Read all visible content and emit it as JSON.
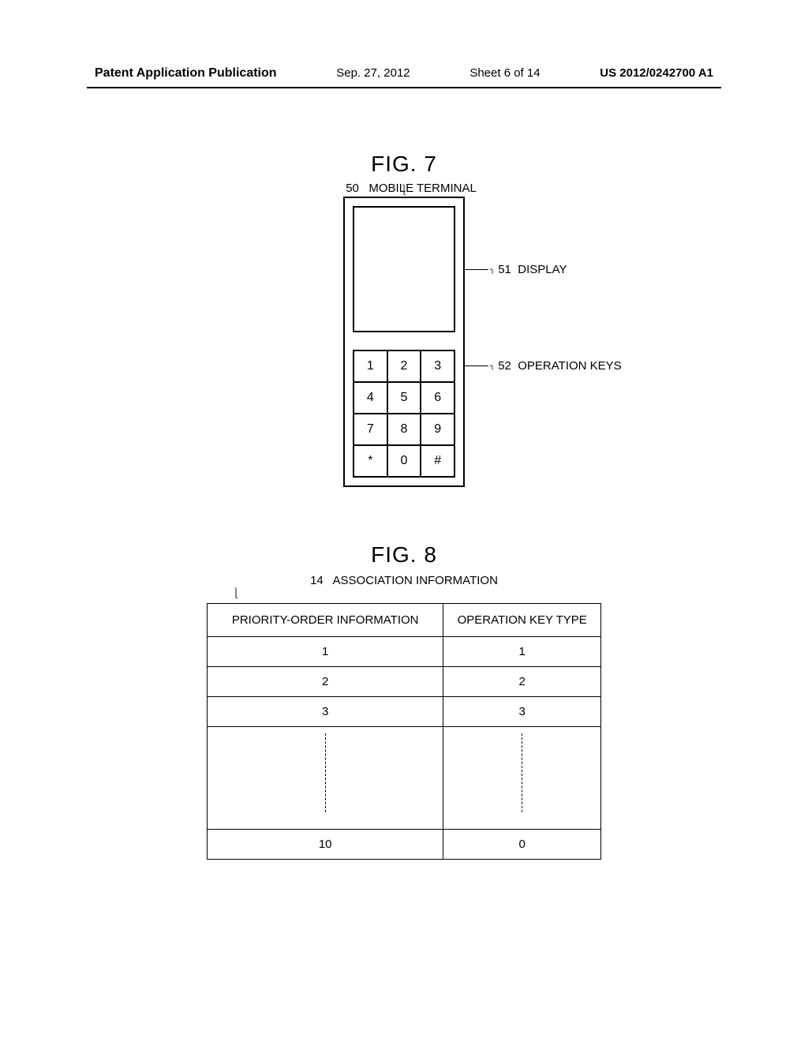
{
  "header": {
    "publication": "Patent Application Publication",
    "date": "Sep. 27, 2012",
    "sheet": "Sheet 6 of 14",
    "pubno": "US 2012/0242700 A1"
  },
  "fig7": {
    "title": "FIG. 7",
    "ref50_num": "50",
    "ref50_label": "MOBILE TERMINAL",
    "ref51_num": "51",
    "ref51_label": "DISPLAY",
    "ref52_num": "52",
    "ref52_label": "OPERATION KEYS",
    "keys": [
      "1",
      "2",
      "3",
      "4",
      "5",
      "6",
      "7",
      "8",
      "9",
      "*",
      "0",
      "#"
    ]
  },
  "fig8": {
    "title": "FIG. 8",
    "ref14_num": "14",
    "ref14_label": "ASSOCIATION INFORMATION",
    "headers": {
      "priority": "PRIORITY-ORDER INFORMATION",
      "keytype": "OPERATION KEY TYPE"
    },
    "rows": [
      {
        "priority": "1",
        "key": "1"
      },
      {
        "priority": "2",
        "key": "2"
      },
      {
        "priority": "3",
        "key": "3"
      }
    ],
    "last": {
      "priority": "10",
      "key": "0"
    }
  }
}
